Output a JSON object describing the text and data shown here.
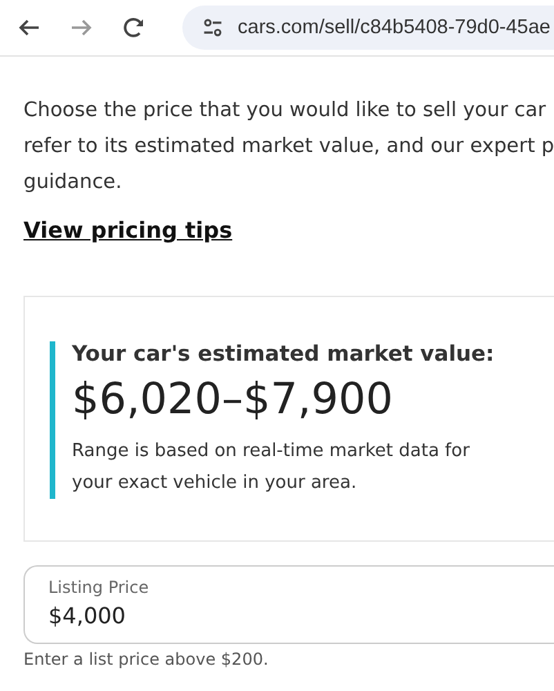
{
  "browser": {
    "url": "cars.com/sell/c84b5408-79d0-45ae"
  },
  "intro": {
    "lines": [
      "Choose the price that you would like to sell your car",
      "refer to its estimated market value, and our expert p",
      "guidance."
    ]
  },
  "tips_link": "View pricing tips",
  "estimate": {
    "title": "Your car's estimated market value:",
    "range": "$6,020–$7,900",
    "note_lines": [
      "Range is based on real-time market data for",
      "your exact vehicle in your area."
    ]
  },
  "listing_price": {
    "label": "Listing Price",
    "value": "$4,000",
    "helper": "Enter a list price above $200."
  }
}
